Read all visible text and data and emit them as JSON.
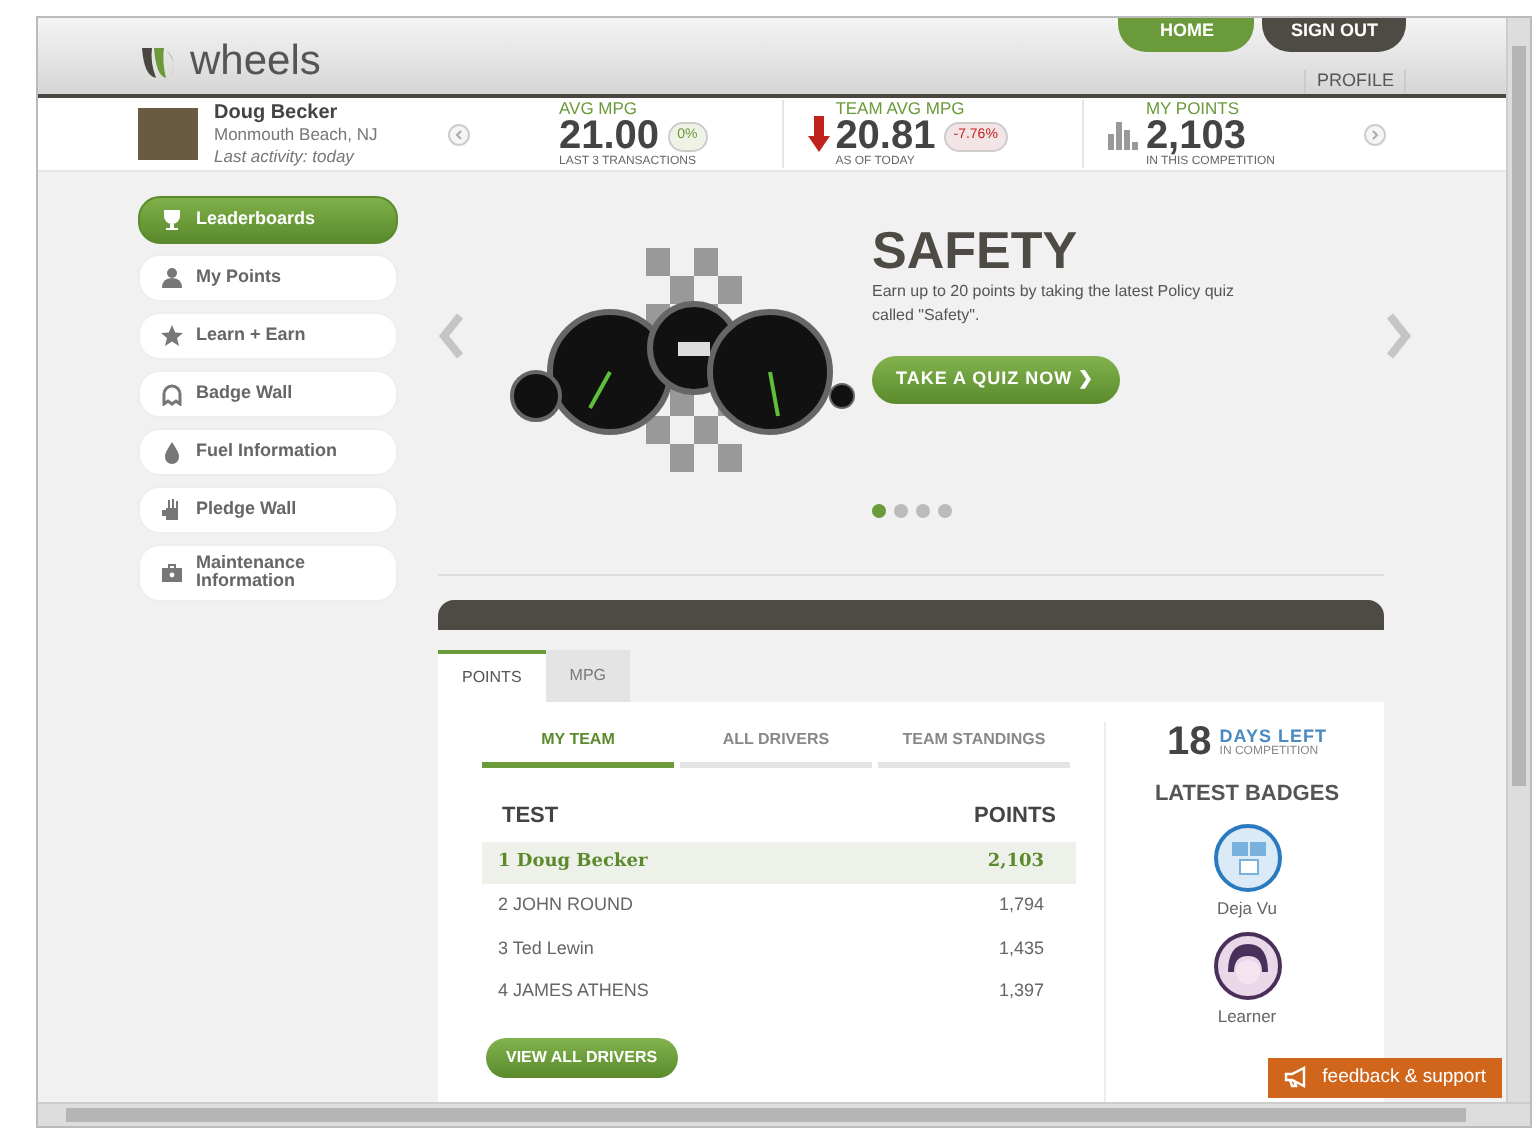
{
  "logo": {
    "text": "wheels"
  },
  "nav": [
    {
      "label": "HOME",
      "selected": true
    },
    {
      "label": "SIGN OUT",
      "selected": false
    }
  ],
  "profile_link": "PROFILE",
  "user": {
    "name": "Doug Becker",
    "location": "Monmouth Beach, NJ",
    "activity": "Last activity: today"
  },
  "stats": [
    {
      "kind": "plain",
      "label": "AVG MPG",
      "value": "21.00",
      "change": "0%",
      "sub": "LAST 3 TRANSACTIONS"
    },
    {
      "kind": "down",
      "label": "TEAM AVG MPG",
      "value": "20.81",
      "change": "-7.76%",
      "sub": "AS OF TODAY"
    },
    {
      "kind": "points",
      "label": "MY POINTS",
      "value": "2,103",
      "sub": "IN THIS COMPETITION"
    }
  ],
  "sidebar": {
    "items": [
      {
        "label": "Leaderboards",
        "selected": true
      },
      {
        "label": "My Points",
        "selected": false
      },
      {
        "label": "Learn + Earn",
        "selected": false
      },
      {
        "label": "Badge Wall",
        "selected": false
      },
      {
        "label": "Fuel Information",
        "selected": false
      },
      {
        "label": "Pledge Wall",
        "selected": false
      },
      {
        "label": "Maintenance Information",
        "selected": false
      }
    ]
  },
  "hero": {
    "title": "SAFETY",
    "text": "Earn up to 20 points by taking the latest Policy quiz called \"Safety\".",
    "button": "TAKE A QUIZ NOW ❯",
    "dots": [
      {
        "selected": true
      },
      {
        "selected": false
      },
      {
        "selected": false
      },
      {
        "selected": false
      }
    ]
  },
  "tabs": [
    {
      "label": "POINTS",
      "selected": true
    },
    {
      "label": "MPG",
      "selected": false
    }
  ],
  "subtabs": [
    {
      "label": "MY TEAM",
      "selected": true
    },
    {
      "label": "ALL DRIVERS",
      "selected": false
    },
    {
      "label": "TEAM STANDINGS",
      "selected": false
    }
  ],
  "table": {
    "columns": [
      "TEST",
      "POINTS"
    ],
    "rows": [
      {
        "name": "1 Doug Becker",
        "points": "2,103",
        "selected": true
      },
      {
        "name": "2 JOHN ROUND",
        "points": "1,794",
        "selected": false
      },
      {
        "name": "3 Ted Lewin",
        "points": "1,435",
        "selected": false
      },
      {
        "name": "4 JAMES ATHENS",
        "points": "1,397",
        "selected": false
      }
    ]
  },
  "view_all_button": "VIEW ALL DRIVERS",
  "days_left": {
    "number": "18",
    "label": "DAYS LEFT",
    "sub": "IN COMPETITION"
  },
  "badges": {
    "title": "LATEST BADGES",
    "items": [
      {
        "kind": "screens",
        "name": "Deja Vu"
      },
      {
        "kind": "face",
        "name": "Learner"
      }
    ]
  },
  "feedback": "feedback & support"
}
